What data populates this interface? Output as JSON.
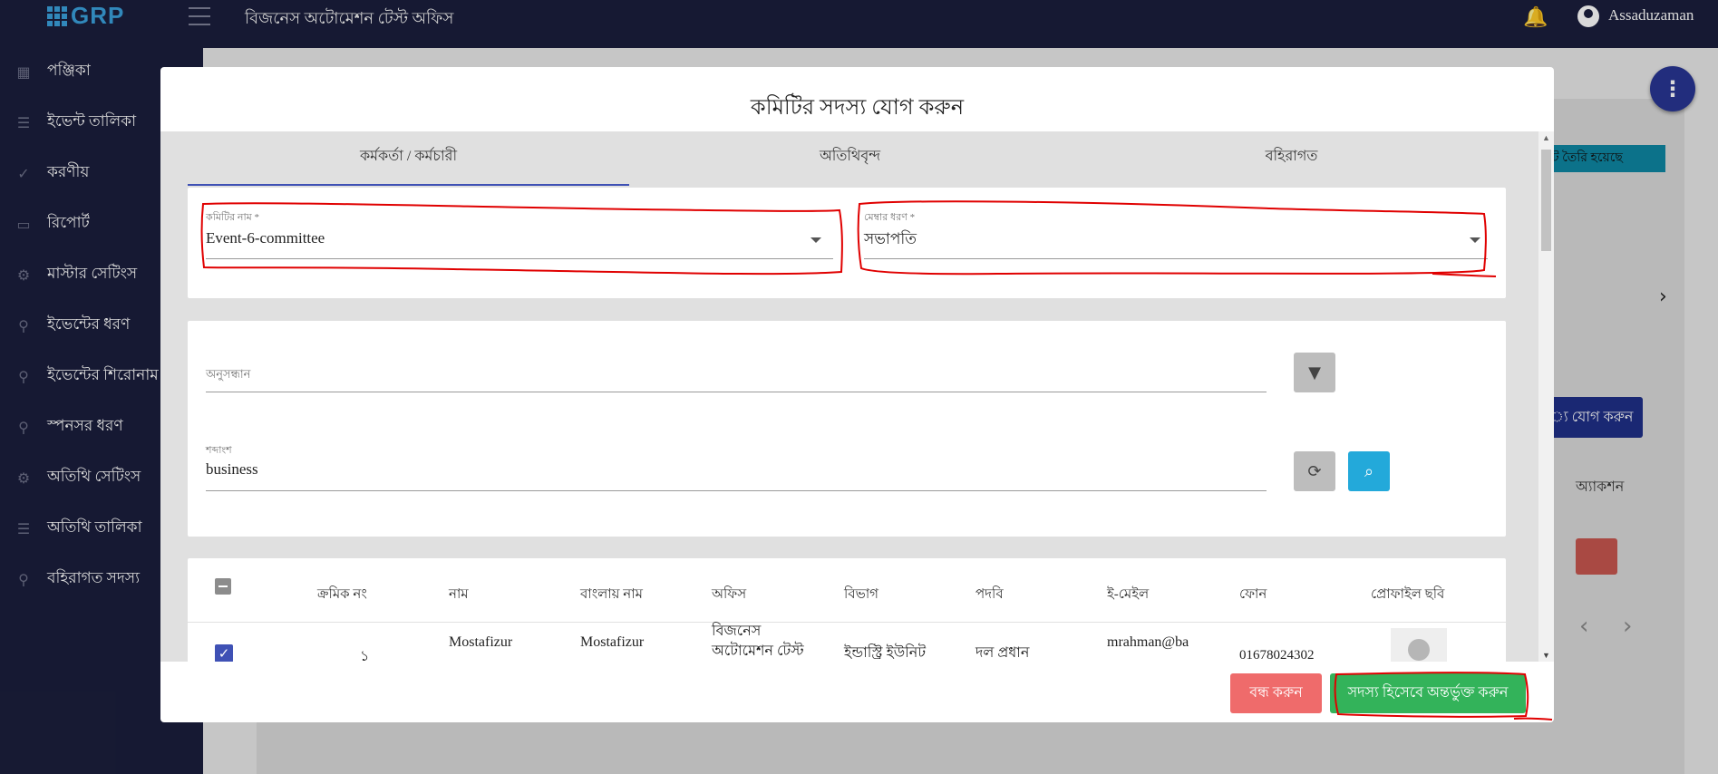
{
  "header": {
    "logo_text": "GRP",
    "office_title": "বিজনেস অটোমেশন টেস্ট অফিস",
    "user_name": "Assaduzaman"
  },
  "sidebar": {
    "items": [
      {
        "label": "পঞ্জিকা",
        "icon": "calendar-icon"
      },
      {
        "label": "ইভেন্ট তালিকা",
        "icon": "list-icon"
      },
      {
        "label": "করণীয়",
        "icon": "check-circle-icon"
      },
      {
        "label": "রিপোর্ট",
        "icon": "inbox-icon"
      },
      {
        "label": "মাস্টার সেটিংস",
        "icon": "gear-icon"
      },
      {
        "label": "ইভেন্টের ধরণ",
        "icon": "location-pin-icon"
      },
      {
        "label": "ইভেন্টের শিরোনাম",
        "icon": "location-pin-icon"
      },
      {
        "label": "স্পনসর ধরণ",
        "icon": "location-pin-icon"
      },
      {
        "label": "অতিথি সেটিংস",
        "icon": "gear-icon"
      },
      {
        "label": "অতিথি তালিকা",
        "icon": "list-icon"
      },
      {
        "label": "বহিরাগত সদস্য",
        "icon": "location-pin-icon"
      }
    ]
  },
  "background": {
    "cyan_badge": "ট তৈরি হয়েছে",
    "add_button": "্য যোগ করুন",
    "action_header": "অ্যাকশন"
  },
  "modal": {
    "title": "কমিটির সদস্য যোগ করুন",
    "tabs": [
      "কর্মকর্তা / কর্মচারী",
      "অতিথিবৃন্দ",
      "বহিরাগত"
    ],
    "committee_field": {
      "label": "কমিটির নাম *",
      "value": "Event-6-committee"
    },
    "member_type_field": {
      "label": "মেম্বার ধরণ *",
      "value": "সভাপতি"
    },
    "search_field": {
      "placeholder": "অনুসন্ধান"
    },
    "keyword_field": {
      "label": "শব্দাংশ",
      "value": "business"
    },
    "table": {
      "headers": [
        "ক্রমিক নং",
        "নাম",
        "বাংলায় নাম",
        "অফিস",
        "বিভাগ",
        "পদবি",
        "ই-মেইল",
        "ফোন",
        "প্রোফাইল ছবি"
      ],
      "rows": [
        {
          "serial": "১",
          "name": "Mostafizur",
          "bangla_name": "Mostafizur",
          "office": "বিজনেস অটোমেশন টেস্ট",
          "department": "ইন্ডাস্ট্রি ইউনিট",
          "designation": "দল প্রধান",
          "email": "mrahman@ba",
          "phone": "01678024302",
          "checked": true
        }
      ]
    },
    "close_button": "বন্ধ করুন",
    "add_member_button": "সদস্য হিসেবে অন্তর্ভুক্ত করুন"
  },
  "colors": {
    "nav_bg": "#1b1e3c",
    "primary": "#3f51b5",
    "close_red": "#ef6b6b",
    "add_green": "#33b35a",
    "search_cyan": "#23a9da",
    "annotation_red": "#e00000"
  }
}
